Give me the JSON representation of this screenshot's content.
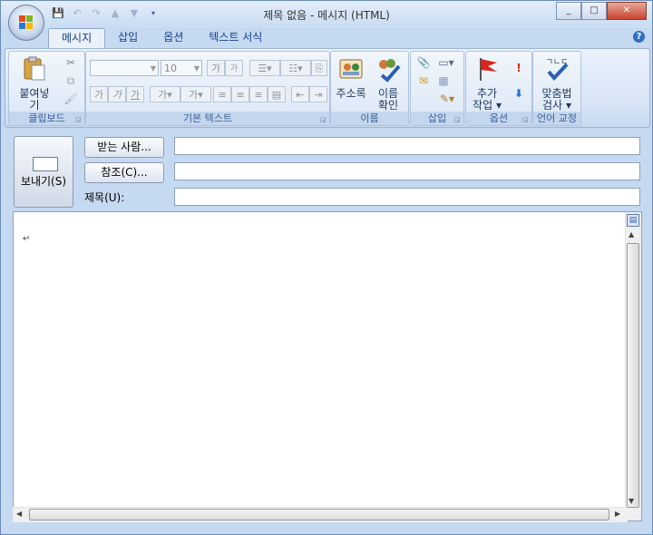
{
  "window": {
    "title": "제목 없음 - 메시지 (HTML)"
  },
  "tabs": [
    {
      "label": "메시지"
    },
    {
      "label": "삽입"
    },
    {
      "label": "옵션"
    },
    {
      "label": "텍스트 서식"
    }
  ],
  "groups": {
    "clipboard": {
      "label": "클립보드",
      "paste_label": "붙여넣기"
    },
    "basic_text": {
      "label": "기본 텍스트",
      "font_size": "10",
      "grow_font": "가",
      "shrink_font": "가",
      "bold": "가",
      "italic": "가",
      "underline": "가",
      "highlight": "가",
      "font_color": "가"
    },
    "names": {
      "label": "이름",
      "address_book": "주소록",
      "check_names_1": "이름",
      "check_names_2": "확인"
    },
    "insert": {
      "label": "삽입"
    },
    "options": {
      "label": "옵션",
      "follow_up_1": "추가",
      "follow_up_2": "작업"
    },
    "proofing": {
      "label": "언어 교정",
      "spell_1": "맞춤법",
      "spell_2": "검사",
      "icon_text": "ㄱㄴㄷ"
    }
  },
  "compose": {
    "send_label": "보내기(S)",
    "to_button": "받는 사람...",
    "cc_button": "참조(C)...",
    "subject_label": "제목(U):",
    "to_value": "",
    "cc_value": "",
    "subject_value": "",
    "body_mark": "↵"
  },
  "colors": {
    "accent": "#15428b",
    "ribbon": "#dbe7f6",
    "flag": "#d9241c"
  }
}
